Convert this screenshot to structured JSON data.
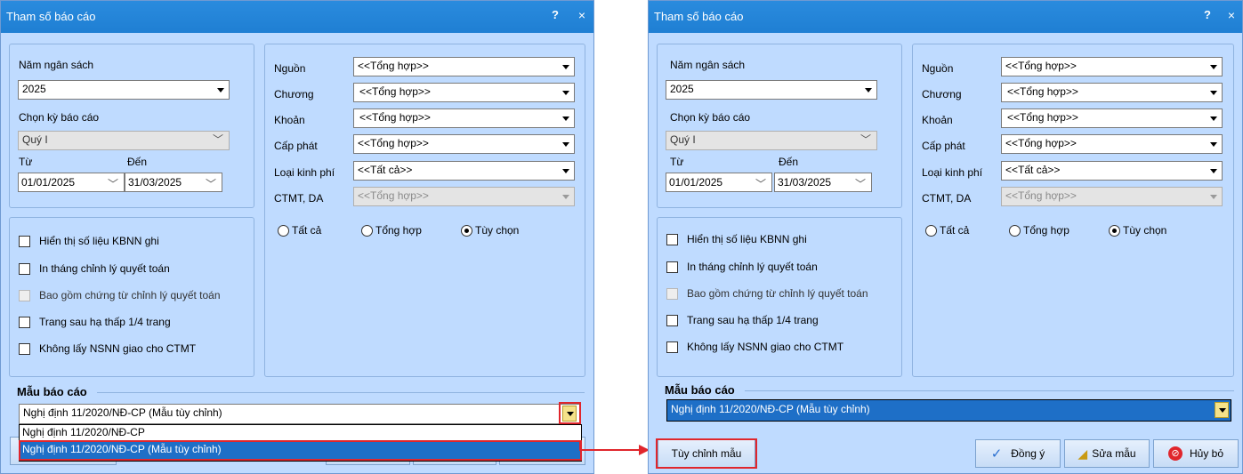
{
  "dialog": {
    "title": "Tham số báo cáo",
    "help": "?",
    "close": "×"
  },
  "left_panel": {
    "nam_ngan_sach_label": "Năm ngân sách",
    "nam_ngan_sach_value": "2025",
    "chon_ky_label": "Chọn kỳ báo cáo",
    "chon_ky_value": "Quý I",
    "tu_label": "Từ",
    "den_label": "Đến",
    "tu_value": "01/01/2025",
    "den_value": "31/03/2025"
  },
  "right_panel": {
    "rows": [
      {
        "label": "Nguồn",
        "value": "<<Tổng hợp>>"
      },
      {
        "label": "Chương",
        "value": "<<Tổng hợp>>"
      },
      {
        "label": "Khoản",
        "value": "<<Tổng hợp>>"
      },
      {
        "label": "Cấp phát",
        "value": "<<Tổng hợp>>"
      },
      {
        "label": "Loại kinh phí",
        "value": "<<Tất cả>>"
      },
      {
        "label": "CTMT, DA",
        "value": "<<Tổng hợp>>"
      }
    ],
    "radios": [
      {
        "label": "Tất cả",
        "selected": false
      },
      {
        "label": "Tổng hợp",
        "selected": false
      },
      {
        "label": "Tùy chọn",
        "selected": true
      }
    ]
  },
  "options": [
    {
      "label": "Hiển thị số liệu KBNN ghi",
      "enabled": true
    },
    {
      "label": "In tháng chỉnh lý quyết toán",
      "enabled": true
    },
    {
      "label": "Bao gồm chứng từ chỉnh lý quyết toán",
      "enabled": false
    },
    {
      "label": "Trang sau hạ thấp 1/4 trang",
      "enabled": true
    },
    {
      "label": "Không lấy NSNN giao cho CTMT",
      "enabled": true
    }
  ],
  "mau_bao_cao": {
    "title": "Mẫu báo cáo",
    "value": "Nghị định 11/2020/NĐ-CP (Mẫu tùy chỉnh)",
    "dropdown_items": [
      "Nghị định 11/2020/NĐ-CP",
      "Nghị định 11/2020/NĐ-CP (Mẫu tùy chỉnh)"
    ]
  },
  "buttons": {
    "tuy_chinh_mau": "Tùy chỉnh mẫu",
    "dong_y": "Đồng ý",
    "sua_mau": "Sửa mẫu",
    "huy_bo": "Hủy bỏ"
  },
  "colors": {
    "dialog_bg": "#bfdbff",
    "title_bar": "#2a8bde",
    "highlight": "#1e6fc7",
    "annotation_red": "#e0262c"
  }
}
